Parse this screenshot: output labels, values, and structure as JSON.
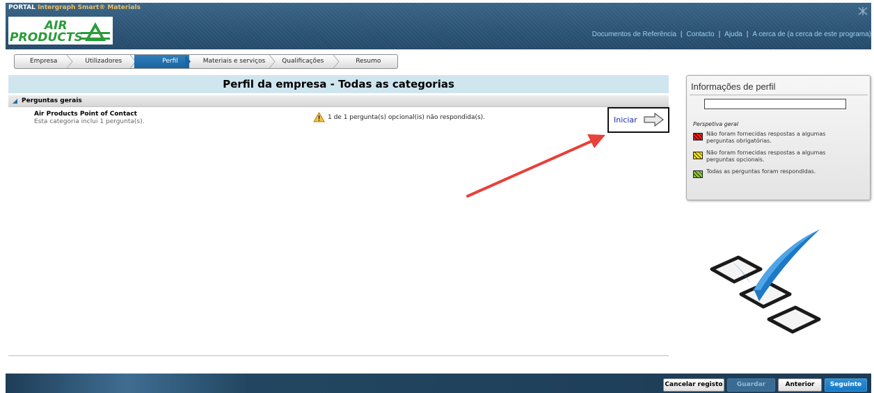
{
  "header": {
    "portal_label": "PORTAL",
    "product_name": "Intergraph Smart",
    "registered_mark": "®",
    "product_suffix": "Materials",
    "logo_text_air": "AIR",
    "logo_text_products": "PRODUCTS",
    "links": [
      {
        "label": "Documentos de Referência"
      },
      {
        "label": "Contacto"
      },
      {
        "label": "Ajuda"
      },
      {
        "label": "A cerca de (a cerca de este programa)"
      }
    ]
  },
  "tabs": [
    {
      "label": "Empresa",
      "active": false
    },
    {
      "label": "Utilizadores",
      "active": false
    },
    {
      "label": "Perfil",
      "active": true
    },
    {
      "label": "Materiais e serviços",
      "active": false
    },
    {
      "label": "Qualificações",
      "active": false
    },
    {
      "label": "Resumo",
      "active": false
    }
  ],
  "main": {
    "title": "Perfil da empresa - Todas as categorias",
    "section": {
      "label": "Perguntas gerais",
      "category": {
        "name": "Air Products Point of Contact",
        "description": "Esta categoria inclui 1 pergunta(s).",
        "status": "1 de 1 pergunta(s) opcional(is) não respondida(s).",
        "start_label": "Iniciar"
      }
    }
  },
  "profile_panel": {
    "title": "Informações de perfil",
    "search_value": "",
    "legend_title": "Perspetiva geral",
    "legend": [
      {
        "text": "Não foram fornecidas respostas a algumas perguntas obrigatórias.",
        "color": "#e02020"
      },
      {
        "text": "Não foram fornecidas respostas a algumas perguntas opcionais.",
        "color": "#f2e21c"
      },
      {
        "text": "Todas as perguntas foram respondidas.",
        "color": "#8cc63f"
      }
    ]
  },
  "footer": {
    "cancel_label": "Cancelar registo",
    "save_label": "Guardar",
    "previous_label": "Anterior",
    "next_label": "Seguinte"
  },
  "colors": {
    "header_bg": "#2f5878",
    "active_tab": "#1f6eab",
    "title_band": "#cfe6ef",
    "link_blue": "#1a2aa8",
    "annotation_red": "#e8403a",
    "footer_primary": "#1677c2"
  }
}
